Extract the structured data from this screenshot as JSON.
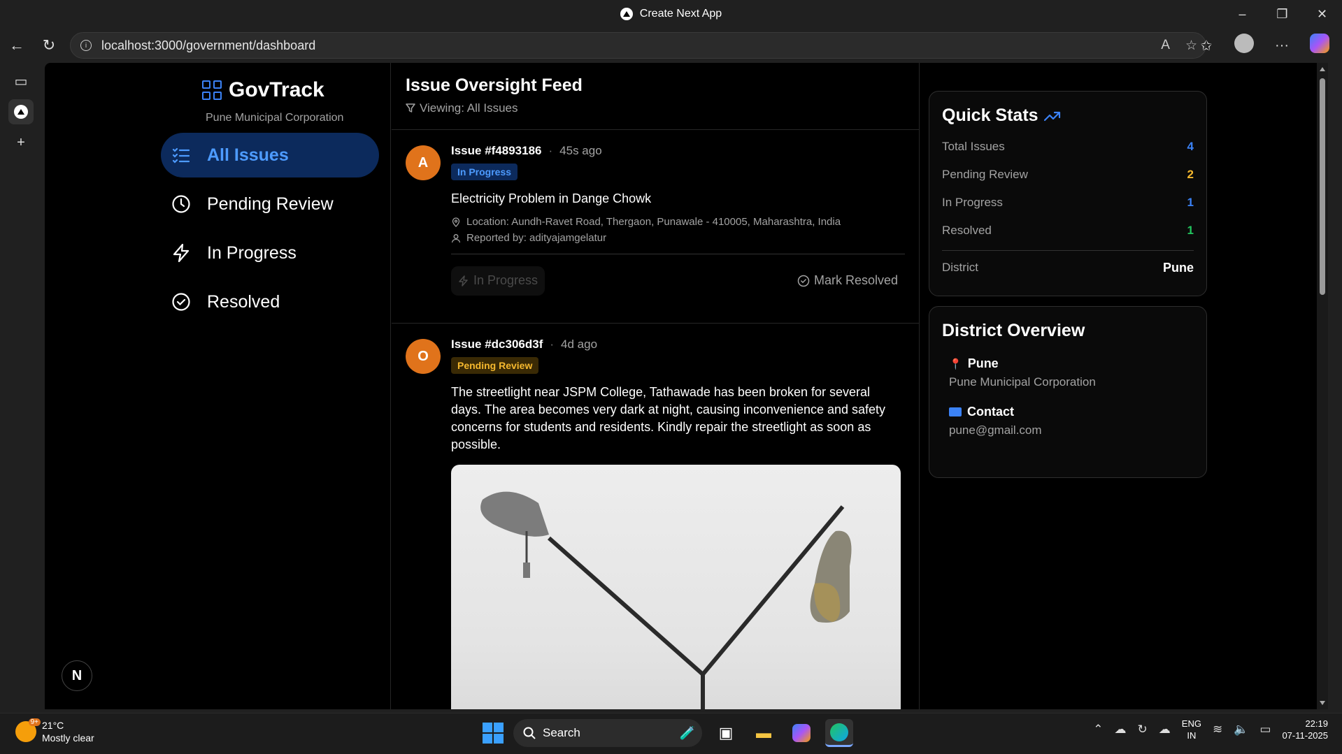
{
  "window": {
    "title": "Create Next App"
  },
  "browser": {
    "url": "localhost:3000/government/dashboard"
  },
  "brand": {
    "name": "GovTrack",
    "subtitle": "Pune Municipal Corporation"
  },
  "nav": {
    "items": [
      {
        "label": "All Issues",
        "icon": "list-check-icon",
        "active": true
      },
      {
        "label": "Pending Review",
        "icon": "clock-icon",
        "active": false
      },
      {
        "label": "In Progress",
        "icon": "bolt-icon",
        "active": false
      },
      {
        "label": "Resolved",
        "icon": "check-circle-icon",
        "active": false
      }
    ],
    "badge": "N"
  },
  "feed": {
    "title": "Issue Oversight Feed",
    "filter": "Viewing: All Issues",
    "issues": [
      {
        "avatar": "A",
        "id": "Issue #f4893186",
        "ago": "45s ago",
        "status": "In Progress",
        "title": "Electricity Problem in Dange Chowk",
        "location": "Location: Aundh-Ravet Road, Thergaon, Punawale - 410005, Maharashtra, India",
        "reporter": "Reported by: adityajamgelatur",
        "action_progress": "In Progress",
        "action_resolve": "Mark Resolved"
      },
      {
        "avatar": "O",
        "id": "Issue #dc306d3f",
        "ago": "4d ago",
        "status": "Pending Review",
        "description": "The streetlight near JSPM College, Tathawade has been broken for several days. The area becomes very dark at night, causing inconvenience and safety concerns for students and residents. Kindly repair the streetlight as soon as possible."
      }
    ]
  },
  "quick_stats": {
    "title": "Quick Stats",
    "rows": [
      {
        "label": "Total Issues",
        "value": "4",
        "color": "#3b82f6"
      },
      {
        "label": "Pending Review",
        "value": "2",
        "color": "#f5b82e"
      },
      {
        "label": "In Progress",
        "value": "1",
        "color": "#3b82f6"
      },
      {
        "label": "Resolved",
        "value": "1",
        "color": "#22c55e"
      }
    ],
    "district_label": "District",
    "district_value": "Pune"
  },
  "district_overview": {
    "title": "District Overview",
    "name": "Pune",
    "corp": "Pune Municipal Corporation",
    "contact_label": "Contact",
    "contact_email": "pune@gmail.com"
  },
  "taskbar": {
    "temp": "21°C",
    "weather": "Mostly clear",
    "weather_badge": "9+",
    "search": "Search",
    "lang1": "ENG",
    "lang2": "IN",
    "time": "22:19",
    "date": "07-11-2025"
  }
}
